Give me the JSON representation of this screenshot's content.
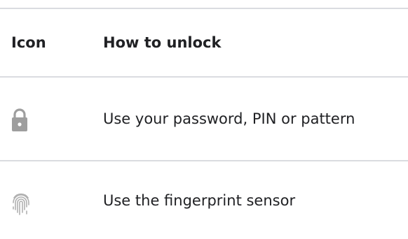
{
  "table": {
    "header": {
      "icon_col": "Icon",
      "method_col": "How to unlock"
    },
    "rows": [
      {
        "icon": "lock-icon",
        "text": "Use your password, PIN or pattern"
      },
      {
        "icon": "fingerprint-icon",
        "text": "Use the fingerprint sensor"
      }
    ]
  },
  "colors": {
    "text": "#202124",
    "divider": "#dadce0",
    "icon_gray": "#9e9e9e"
  }
}
